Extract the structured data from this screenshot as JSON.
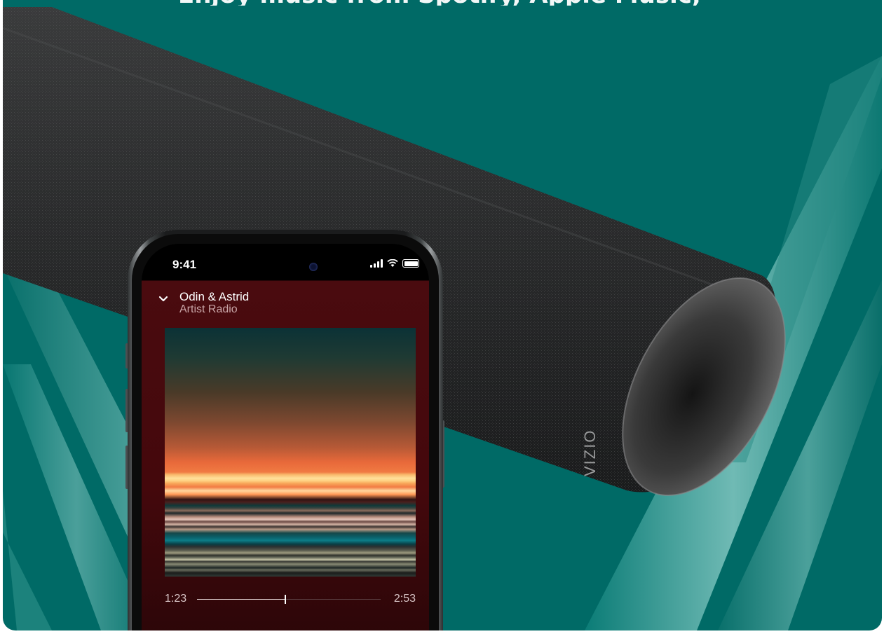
{
  "background": {
    "color": "#006a66",
    "headline_partial": "Enjoy music from Spotify, Apple Music,"
  },
  "soundbar": {
    "logo": "VIZIO",
    "fabric_color": "#2b2c2d"
  },
  "phone": {
    "status": {
      "time": "9:41"
    },
    "now_playing": {
      "title": "Odin & Astrid",
      "subtitle": "Artist Radio",
      "collapse_icon": "chevron-down-icon"
    },
    "progress": {
      "elapsed": "1:23",
      "duration": "2:53",
      "fraction": 0.48
    }
  }
}
